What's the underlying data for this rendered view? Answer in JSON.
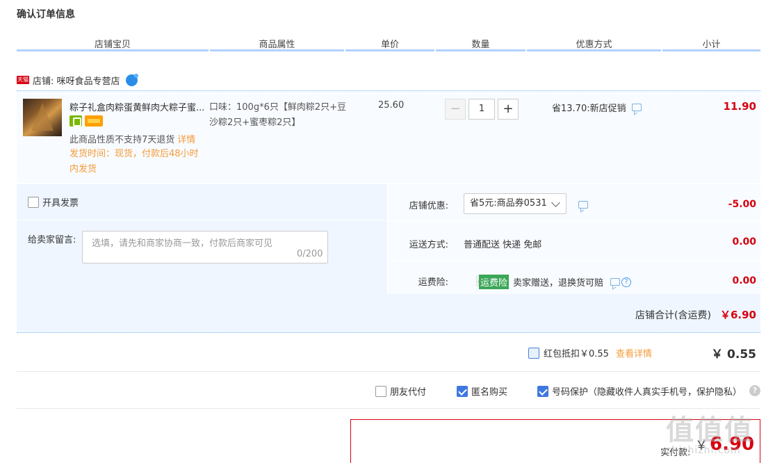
{
  "page": {
    "title": "确认订单信息"
  },
  "columns": [
    "店铺宝贝",
    "商品属性",
    "单价",
    "数量",
    "优惠方式",
    "小计"
  ],
  "shop": {
    "badge": "天猫",
    "label": "店铺: 咪呀食品专营店"
  },
  "item": {
    "title": "粽子礼盒肉粽蛋黄鲜肉大粽子蜜...",
    "no_return": "此商品性质不支持7天退货",
    "details_link": "详情",
    "ship_time": "发货时间：现货，付款后48小时内发货",
    "attribute": "口味：100g*6只【鲜肉粽2只+豆沙粽2只+蜜枣粽2只】",
    "price": "25.60",
    "quantity": "1",
    "minus": "−",
    "plus": "+",
    "promotion": "省13.70:新店促销",
    "subtotal": "11.90"
  },
  "invoice": {
    "label": "开具发票"
  },
  "memo": {
    "label": "给卖家留言:",
    "placeholder": "选填，请先和商家协商一致，付款后商家可见",
    "count": "0/200"
  },
  "store_coupon": {
    "label": "店铺优惠:",
    "selected": "省5元:商品券0531",
    "amount": "-5.00"
  },
  "shipping": {
    "label": "运送方式:",
    "value": "普通配送 快递 免邮",
    "amount": "0.00"
  },
  "insurance": {
    "label": "运费险:",
    "tag": "运费险",
    "text": "卖家赠送，退换货可赔",
    "help": "?",
    "amount": "0.00"
  },
  "store_total": {
    "label": "店铺合计(含运费)",
    "value": "￥6.90"
  },
  "red_packet": {
    "label": "红包抵扣￥0.55",
    "link": "查看详情",
    "value": "￥ 0.55"
  },
  "options": {
    "friend_pay": "朋友代付",
    "anonymous": "匿名购买",
    "number_protect": "号码保护（隐藏收件人真实手机号，保护隐私）",
    "help": "?"
  },
  "payment": {
    "label": "实付款:",
    "currency": "￥",
    "value": "6.90"
  },
  "watermark": {
    "text": "值值值",
    "site": "zhizhizhi.com"
  },
  "colors": {
    "accent_red": "#d7000f",
    "link_orange": "#f59b39",
    "header_line": "#b2d1ff",
    "panel_blue": "#eff6ff",
    "check_blue": "#3f77e0"
  }
}
